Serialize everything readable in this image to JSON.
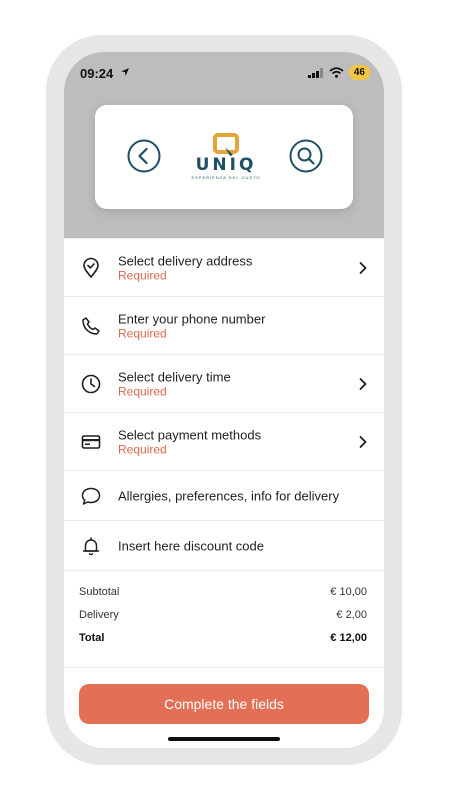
{
  "status_bar": {
    "time": "09:24",
    "battery": "46"
  },
  "header": {
    "logo_text": "UNIQ",
    "logo_tagline": "ESPERIENZA DEL GUSTO"
  },
  "menu": [
    {
      "title": "Select delivery address",
      "subtitle": "Required",
      "icon": "location-pin-icon",
      "chevron": true
    },
    {
      "title": "Enter your phone number",
      "subtitle": "Required",
      "icon": "phone-icon",
      "chevron": false
    },
    {
      "title": "Select delivery time",
      "subtitle": "Required",
      "icon": "clock-icon",
      "chevron": true
    },
    {
      "title": "Select payment methods",
      "subtitle": "Required",
      "icon": "credit-card-icon",
      "chevron": true
    },
    {
      "title": "Allergies, preferences, info for delivery",
      "icon": "chat-bubble-icon",
      "chevron": false
    },
    {
      "title": "Insert here discount code",
      "icon": "bell-icon",
      "chevron": false
    }
  ],
  "totals": {
    "subtotal_label": "Subtotal",
    "subtotal_value": "€ 10,00",
    "delivery_label": "Delivery",
    "delivery_value": "€ 2,00",
    "total_label": "Total",
    "total_value": "€ 12,00"
  },
  "cta": {
    "label": "Complete the fields"
  },
  "colors": {
    "accent": "#e26f56",
    "required_text": "#d9694f",
    "brand_navy": "#1d4f66",
    "brand_gold": "#e3a53a"
  }
}
